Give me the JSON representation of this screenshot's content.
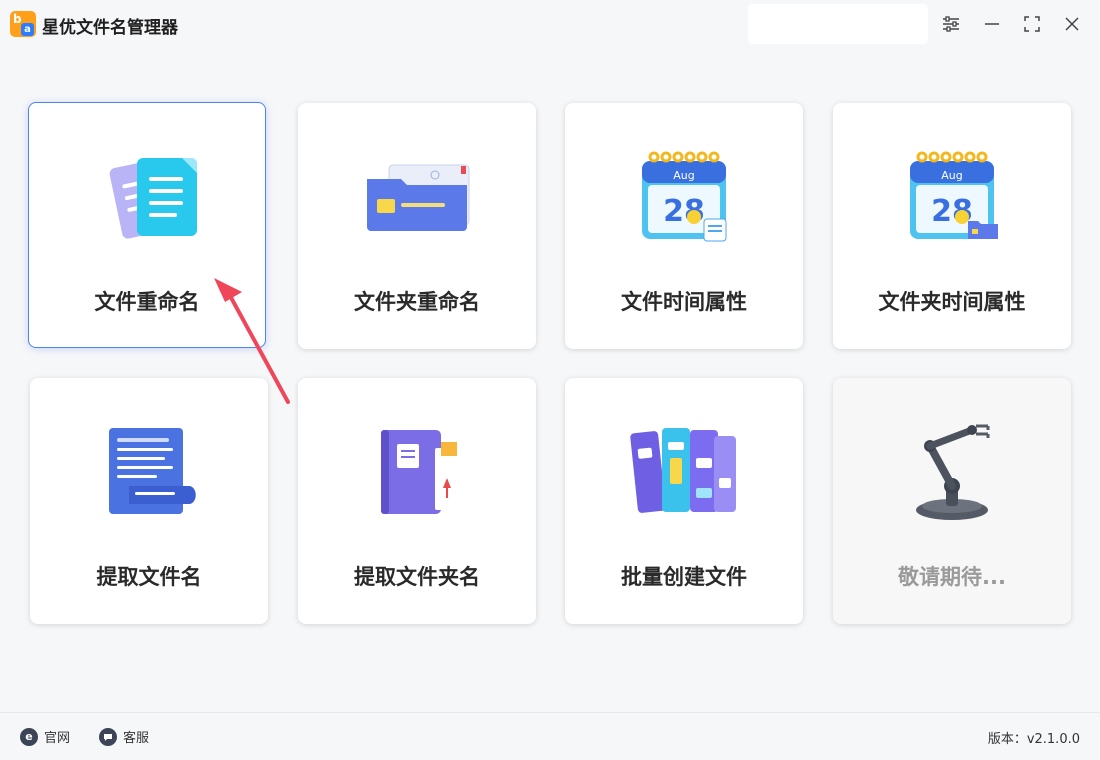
{
  "app": {
    "title": "星优文件名管理器",
    "logo_text_b": "b",
    "logo_text_a": "a"
  },
  "window_controls": [
    "settings-icon",
    "minimize-icon",
    "maximize-icon",
    "close-icon"
  ],
  "cards": [
    {
      "label": "文件重命名",
      "icon": "documents-icon",
      "selected": true
    },
    {
      "label": "文件夹重命名",
      "icon": "folder-icon"
    },
    {
      "label": "文件时间属性",
      "icon": "calendar-icon"
    },
    {
      "label": "文件夹时间属性",
      "icon": "calendar-folder-icon"
    },
    {
      "label": "提取文件名",
      "icon": "scroll-icon"
    },
    {
      "label": "提取文件夹名",
      "icon": "binder-icon"
    },
    {
      "label": "批量创建文件",
      "icon": "books-icon"
    },
    {
      "label": "敬请期待...",
      "icon": "robot-arm-icon",
      "disabled": true
    }
  ],
  "calendar_month": "Aug",
  "calendar_day": "28",
  "footer": {
    "website_label": "官网",
    "website_icon_text": "e",
    "service_label": "客服",
    "version": "版本：v2.1.0.0"
  },
  "colors": {
    "accent": "#4f83f2",
    "arrow": "#f0465a",
    "logo": "#ff9f1a"
  }
}
